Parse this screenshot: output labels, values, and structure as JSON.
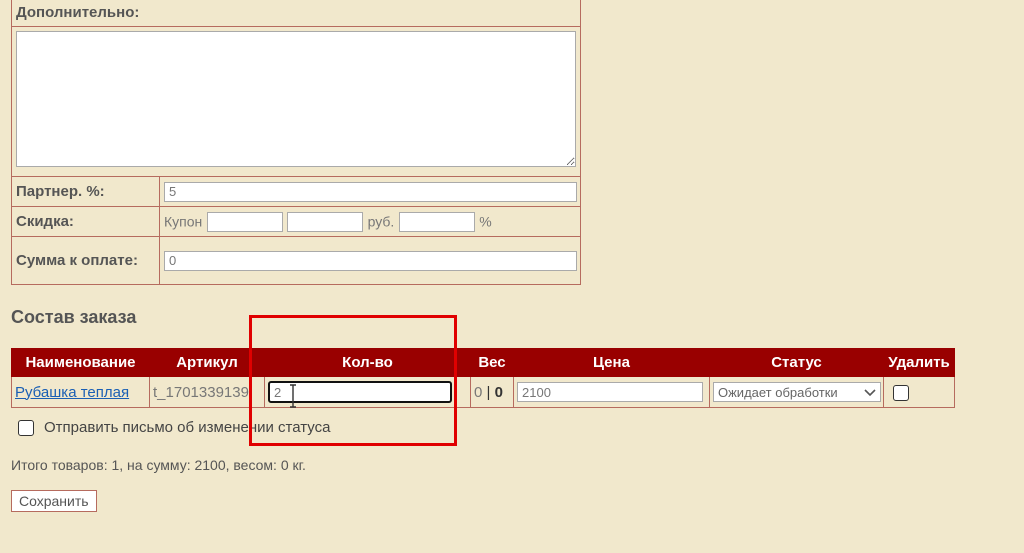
{
  "form": {
    "additional_label": "Дополнительно:",
    "additional_value": "",
    "partner_label": "Партнер. %:",
    "partner_value": "5",
    "discount_label": "Скидка:",
    "coupon_label": "Купон",
    "coupon_value": "",
    "discount_rub_value": "",
    "rub_label": "руб.",
    "discount_pct_value": "",
    "pct_label": "%",
    "payable_label": "Сумма к оплате:",
    "payable_value": "0"
  },
  "order": {
    "section_title": "Состав заказа",
    "columns": [
      "Наименование",
      "Артикул",
      "Кол-во",
      "Вес",
      "Цена",
      "Статус",
      "Удалить"
    ],
    "rows": [
      {
        "name": "Рубашка теплая",
        "sku": "t_1701339139",
        "qty": "2",
        "weight_a": "0",
        "weight_sep": "|",
        "weight_b": "0",
        "price": "2100",
        "status": "Ожидает обработки"
      }
    ],
    "notify_label": "Отправить письмо об изменении статуса",
    "total_text": "Итого товаров: 1, на сумму: 2100, весом: 0 кг.",
    "save_label": "Сохранить"
  },
  "icons": {
    "dropdown": "chevron-down-icon",
    "cursor": "text-cursor-icon"
  },
  "colors": {
    "background": "#f1e8cc",
    "header": "#990000",
    "border": "#b66b5e",
    "highlight": "#e00000",
    "link": "#1a5fb4"
  }
}
